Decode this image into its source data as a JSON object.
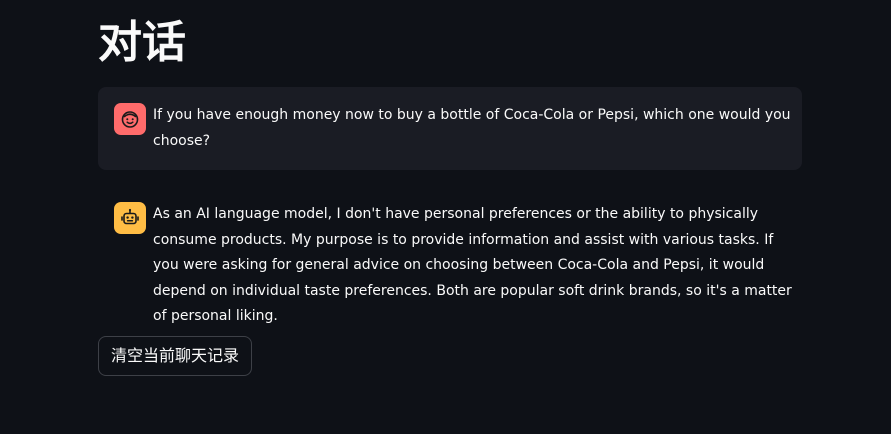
{
  "header": {
    "title": "对话"
  },
  "messages": [
    {
      "role": "user",
      "avatar_icon": "smiley-face-icon",
      "avatar_color": "#ff6b6b",
      "text": "If you have enough money now to buy a bottle of Coca-Cola or Pepsi, which one would you choose?"
    },
    {
      "role": "assistant",
      "avatar_icon": "robot-icon",
      "avatar_color": "#ffbd45",
      "text": "As an AI language model, I don't have personal preferences or the ability to physically consume products. My purpose is to provide information and assist with various tasks. If you were asking for general advice on choosing between Coca-Cola and Pepsi, it would depend on individual taste preferences. Both are popular soft drink brands, so it's a matter of personal liking."
    }
  ],
  "actions": {
    "clear_label": "清空当前聊天记录"
  },
  "theme": {
    "background": "#0e1117",
    "user_message_background": "#1a1c24",
    "text": "#fafafa"
  }
}
